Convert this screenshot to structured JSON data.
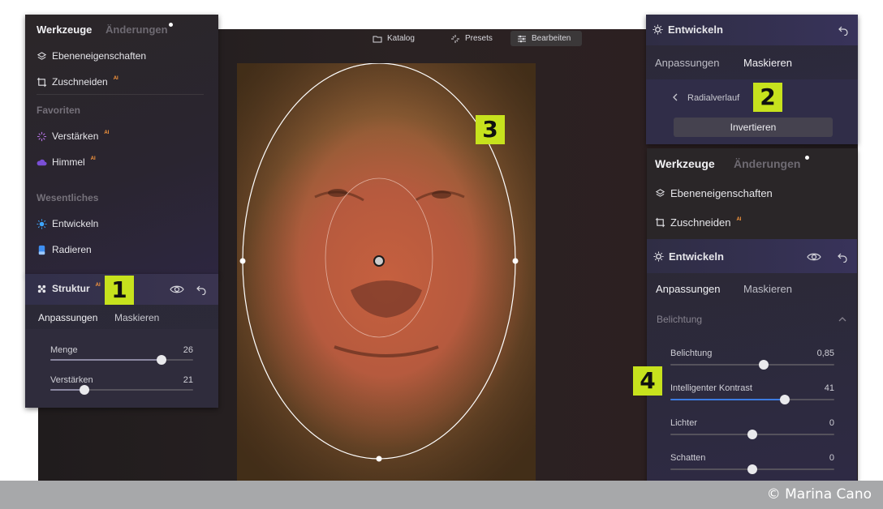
{
  "topbar": {
    "katalog": "Katalog",
    "presets": "Presets",
    "bearbeiten": "Bearbeiten"
  },
  "left_panel": {
    "tab_tools": "Werkzeuge",
    "tab_changes": "Änderungen",
    "items": {
      "ebenen": "Ebeneneigenschaften",
      "zuschneiden": "Zuschneiden",
      "verstaerken": "Verstärken",
      "himmel": "Himmel",
      "entwickeln": "Entwickeln",
      "radieren": "Radieren"
    },
    "section_favorites": "Favoriten",
    "section_essentials": "Wesentliches",
    "ai_mark": "AI"
  },
  "struktur_panel": {
    "title": "Struktur",
    "tab_adjust": "Anpassungen",
    "tab_mask": "Maskieren",
    "sliders": [
      {
        "label": "Menge",
        "value": "26",
        "fraction": 0.78
      },
      {
        "label": "Verstärken",
        "value": "21",
        "fraction": 0.24
      }
    ]
  },
  "top_right_panel": {
    "title": "Entwickeln",
    "tab_adjust": "Anpassungen",
    "tab_mask": "Maskieren",
    "back_label": "Radialverlauf",
    "invert_button": "Invertieren"
  },
  "right_panel": {
    "tab_tools": "Werkzeuge",
    "tab_changes": "Änderungen",
    "ebenen": "Ebeneneigenschaften",
    "zuschneiden": "Zuschneiden",
    "develop_title": "Entwickeln",
    "tab_adjust": "Anpassungen",
    "tab_mask": "Maskieren",
    "section": "Belichtung",
    "sliders": [
      {
        "label": "Belichtung",
        "value": "0,85",
        "fraction": 0.57,
        "filled": false
      },
      {
        "label": "Intelligenter Kontrast",
        "value": "41",
        "fraction": 0.7,
        "filled": true
      },
      {
        "label": "Lichter",
        "value": "0",
        "fraction": 0.5,
        "filled": false
      },
      {
        "label": "Schatten",
        "value": "0",
        "fraction": 0.5,
        "filled": false
      }
    ]
  },
  "badges": [
    "1",
    "2",
    "3",
    "4"
  ],
  "credit": "© Marina Cano",
  "colors": {
    "accent_ai": "#ff9a3d",
    "badge": "#c7e21d",
    "slider_fill": "#3d7be0",
    "mask_overlay": "#c6603f"
  },
  "icons": {
    "katalog": "folder-icon",
    "presets": "sparkle-icon",
    "bearbeiten": "sliders-icon",
    "ebenen": "layers-icon",
    "zuschneiden": "crop-icon",
    "verstaerken": "sparkle-icon",
    "himmel": "cloud-icon",
    "entwickeln": "sun-icon",
    "radieren": "eraser-icon",
    "struktur": "structure-icon",
    "visibility": "eye-icon",
    "reset": "undo-icon",
    "back": "chevron-left-icon",
    "collapse": "chevron-up-icon"
  }
}
